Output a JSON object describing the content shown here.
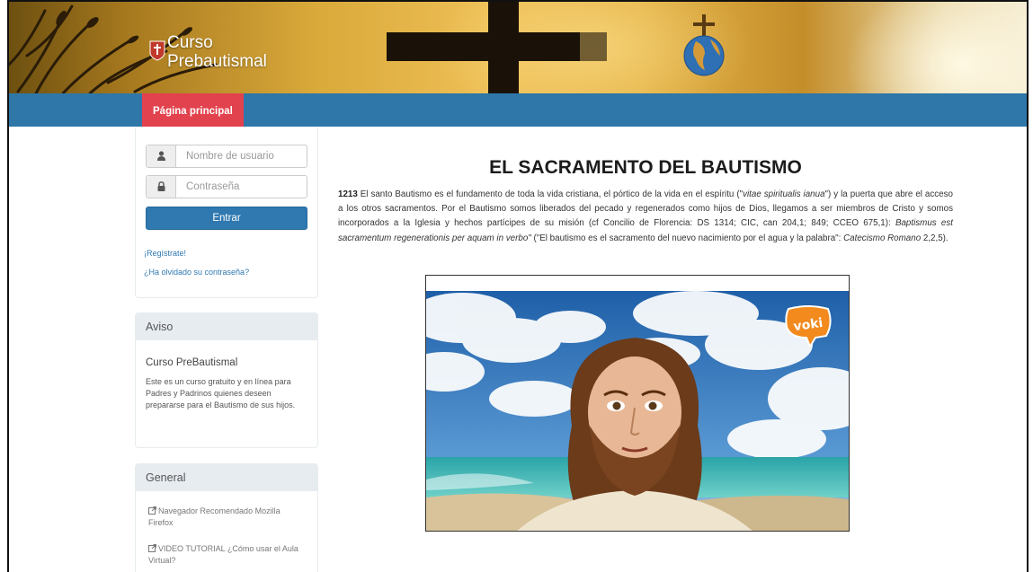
{
  "site": {
    "logo_line1": "Curso",
    "logo_line2": "Prebautismal"
  },
  "nav": {
    "active_item": "Página principal"
  },
  "login": {
    "username_placeholder": "Nombre de usuario",
    "password_placeholder": "Contraseña",
    "submit_label": "Entrar",
    "register_link": "¡Regístrate!",
    "forgot_link": "¿Ha olvidado su contraseña?"
  },
  "notice_panel": {
    "header": "Aviso",
    "title": "Curso PreBautismal",
    "text": "Este es un curso gratuito y en línea para Padres y Padrinos quienes deseen prepararse para el Bautismo de sus hijos."
  },
  "general_panel": {
    "header": "General",
    "links": [
      "Navegador Recomendado Mozilla Firefox",
      "VIDEO TUTORIAL ¿Cómo usar el Aula Virtual?"
    ]
  },
  "main": {
    "title": "EL SACRAMENTO DEL BAUTISMO",
    "paragraph": {
      "number": "1213",
      "t1": " El santo Bautismo es el fundamento de toda la vida cristiana, el pórtico de la vida en el espíritu (\"",
      "i1": "vitae spiritualis ianua",
      "t2": "\") y la puerta que abre el acceso a los otros sacramentos. Por el Bautismo somos liberados del pecado y regenerados como hijos de Dios, llegamos a ser miembros de Cristo y somos incorporados a la Iglesia y hechos partícipes de su misión (cf Concilio de Florencia: DS 1314; CIC, can 204,1; 849; CCEO 675,1): ",
      "i2": "Baptismus est sacramentum regenerationis per aquam in verbo\"",
      "t3": " (\"El bautismo es el sacramento del nuevo nacimiento por el agua y la palabra\": ",
      "i3": "Catecismo Romano",
      "t4": " 2,2,5)."
    },
    "video_brand": "voki"
  },
  "colors": {
    "navbar": "#2e77a8",
    "nav_active": "#e2424d",
    "button": "#2f78b0",
    "panel_header": "#e7ecf1"
  }
}
